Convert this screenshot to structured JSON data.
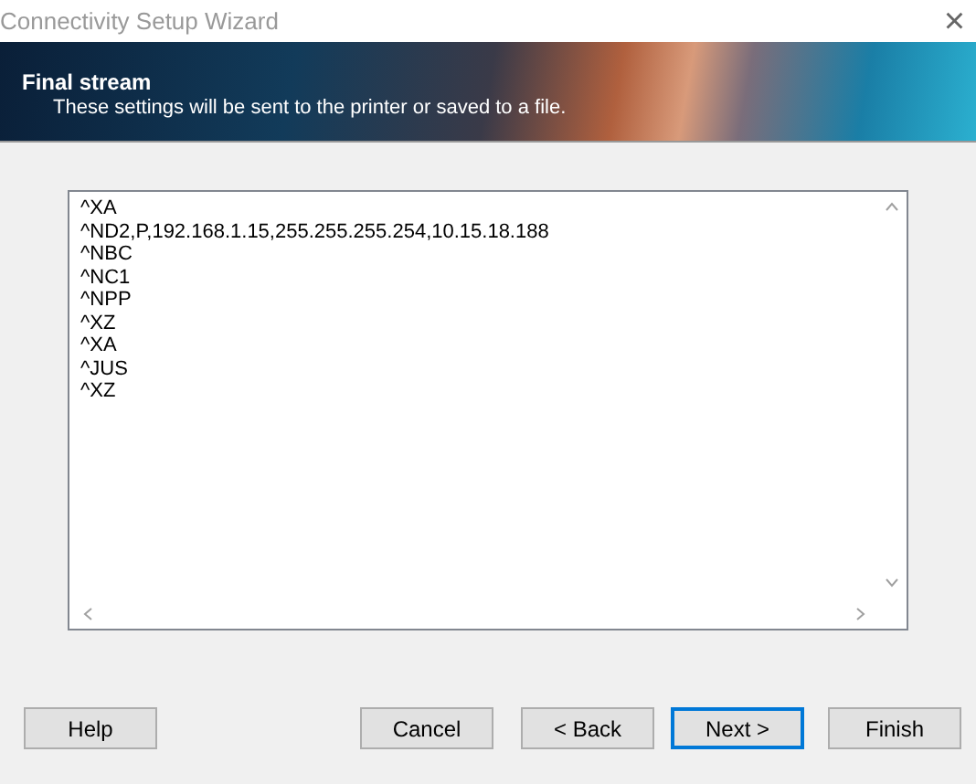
{
  "window": {
    "title": "Connectivity Setup Wizard",
    "close": "×"
  },
  "header": {
    "title": "Final stream",
    "subtitle": "These settings will be sent to the printer or saved to a file."
  },
  "stream_lines": [
    "^XA",
    "^ND2,P,192.168.1.15,255.255.255.254,10.15.18.188",
    "^NBC",
    "^NC1",
    "^NPP",
    "^XZ",
    "^XA",
    "^JUS",
    "^XZ"
  ],
  "help_buttons": [
    {
      "label": "Help",
      "focused": false
    }
  ],
  "nav_buttons": [
    {
      "label": "Cancel",
      "focused": false
    },
    {
      "label": "< Back",
      "focused": false
    },
    {
      "label": "Next >",
      "focused": true
    },
    {
      "label": "Finish",
      "focused": false
    }
  ]
}
